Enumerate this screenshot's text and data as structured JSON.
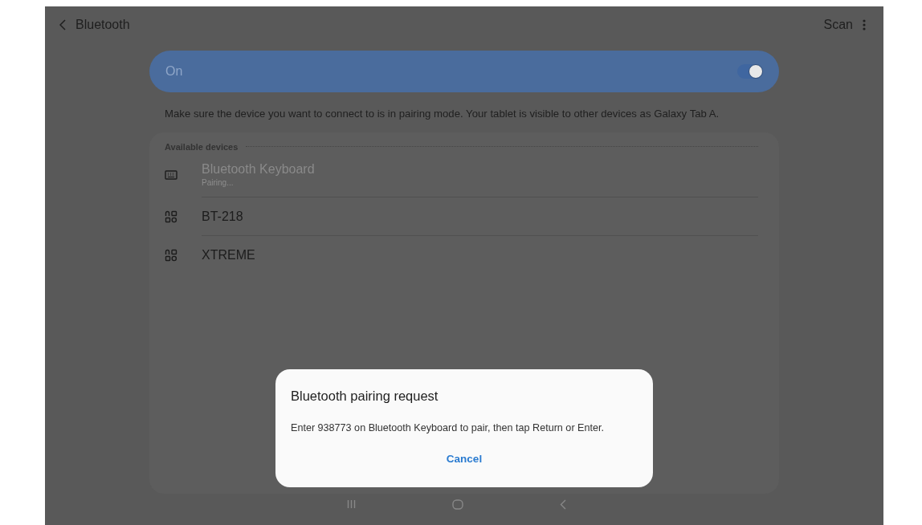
{
  "header": {
    "title": "Bluetooth",
    "actions": [
      "Scan"
    ]
  },
  "master_switch": {
    "label": "On",
    "on": true
  },
  "description": "Make sure the device you want to connect to is in pairing mode. Your tablet is visible to other devices as Galaxy Tab A.",
  "available_devices": {
    "heading": "Available devices",
    "devices": [
      {
        "kind": "keyboard",
        "name": "Bluetooth Keyboard",
        "status": "Pairing...",
        "disabled": true
      },
      {
        "kind": "other",
        "name": "BT-218",
        "disabled": false
      },
      {
        "kind": "other",
        "name": "XTREME",
        "disabled": false
      }
    ]
  },
  "dialog": {
    "title": "Bluetooth pairing request",
    "message": "Enter 938773 on Bluetooth Keyboard to pair, then tap Return or Enter.",
    "buttons": [
      "Cancel"
    ]
  }
}
